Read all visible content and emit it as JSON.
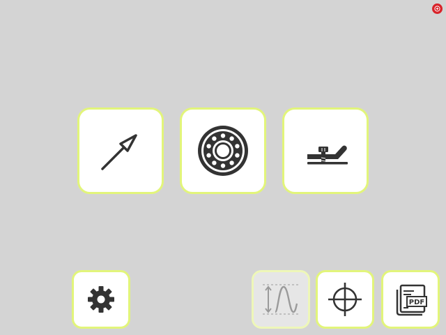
{
  "colors": {
    "background": "#d4d4d4",
    "tile_border": "#e2f57a",
    "tile_fill": "#ffffff",
    "icon": "#333333",
    "disabled_icon": "#9a9a9a",
    "badge": "#d8232a"
  },
  "main_tiles": [
    {
      "icon": "probe-needle-icon"
    },
    {
      "icon": "ball-bearing-icon"
    },
    {
      "icon": "clamp-fixture-icon"
    }
  ],
  "bottom_toolbar": {
    "settings": {
      "icon": "gear-icon"
    },
    "waveform": {
      "icon": "waveform-icon",
      "enabled": false
    },
    "target": {
      "icon": "crosshair-icon"
    },
    "pdf_report": {
      "icon": "pdf-report-icon",
      "label": "PDF"
    }
  },
  "status": {
    "icon": "corner-logo-icon"
  }
}
